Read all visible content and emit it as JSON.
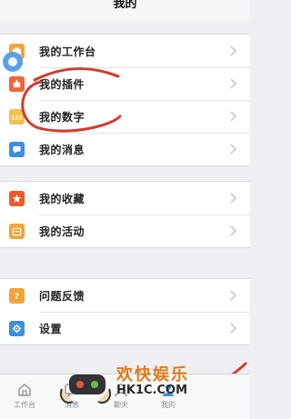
{
  "header": {
    "title": "我的"
  },
  "groups": [
    {
      "items": [
        {
          "label": "我的工作台",
          "icon": "workbench-icon",
          "color": "#f2a43a"
        },
        {
          "label": "我的插件",
          "icon": "plugin-icon",
          "color": "#f0643c"
        },
        {
          "label": "我的数字",
          "icon": "number-icon",
          "color": "#f3c04a"
        },
        {
          "label": "我的消息",
          "icon": "message-icon",
          "color": "#3a8fe0"
        }
      ]
    },
    {
      "items": [
        {
          "label": "我的收藏",
          "icon": "star-icon",
          "color": "#f05a28"
        },
        {
          "label": "我的活动",
          "icon": "activity-icon",
          "color": "#f2a43a"
        }
      ]
    },
    {
      "items": [
        {
          "label": "问题反馈",
          "icon": "feedback-icon",
          "color": "#f2a43a"
        },
        {
          "label": "设置",
          "icon": "gear-icon",
          "color": "#3a8fe0"
        }
      ]
    }
  ],
  "tabbar": {
    "items": [
      {
        "label": "工作台",
        "icon": "home-icon"
      },
      {
        "label": "消息",
        "icon": "chat-icon"
      },
      {
        "label": "聊天",
        "icon": "contacts-icon"
      },
      {
        "label": "我的",
        "icon": "me-icon"
      }
    ]
  },
  "watermark": {
    "text": "欢快娱乐",
    "url": "HK1C.COM"
  },
  "colors": {
    "annotation_red": "#d23a2c",
    "accent_blue": "#3a8fe0"
  }
}
